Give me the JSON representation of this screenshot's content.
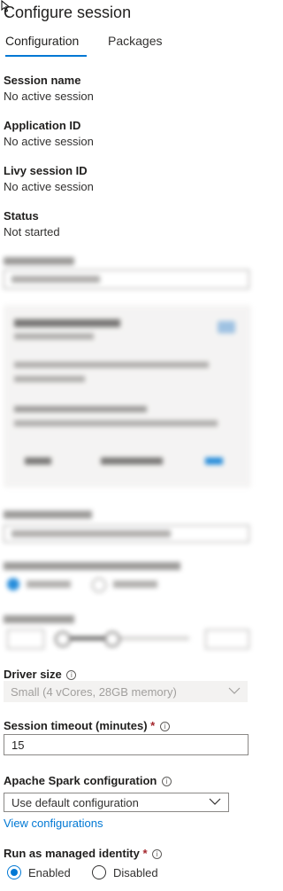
{
  "header": {
    "title": "Configure session"
  },
  "tabs": [
    {
      "label": "Configuration",
      "active": true
    },
    {
      "label": "Packages",
      "active": false
    }
  ],
  "info": [
    {
      "label": "Session name",
      "value": "No active session"
    },
    {
      "label": "Application ID",
      "value": "No active session"
    },
    {
      "label": "Livy session ID",
      "value": "No active session"
    },
    {
      "label": "Status",
      "value": "Not started"
    }
  ],
  "driver_size": {
    "label": "Driver size",
    "required_mark": "*",
    "value": "Small (4 vCores, 28GB memory)"
  },
  "session_timeout": {
    "label": "Session timeout (minutes)",
    "required_mark": "*",
    "value": "15"
  },
  "spark_config": {
    "label": "Apache Spark configuration",
    "value": "Use default configuration",
    "view_link": "View configurations"
  },
  "managed_identity": {
    "label": "Run as managed identity",
    "required_mark": "*",
    "options": [
      {
        "label": "Enabled",
        "selected": true
      },
      {
        "label": "Disabled",
        "selected": false
      }
    ]
  },
  "icons": {
    "info": "info-icon",
    "chevron": "chevron-down-icon",
    "cursor": "mouse-pointer-icon"
  },
  "colors": {
    "accent": "#0078d4",
    "required": "#a4262c",
    "disabled_bg": "#f3f2f1"
  }
}
